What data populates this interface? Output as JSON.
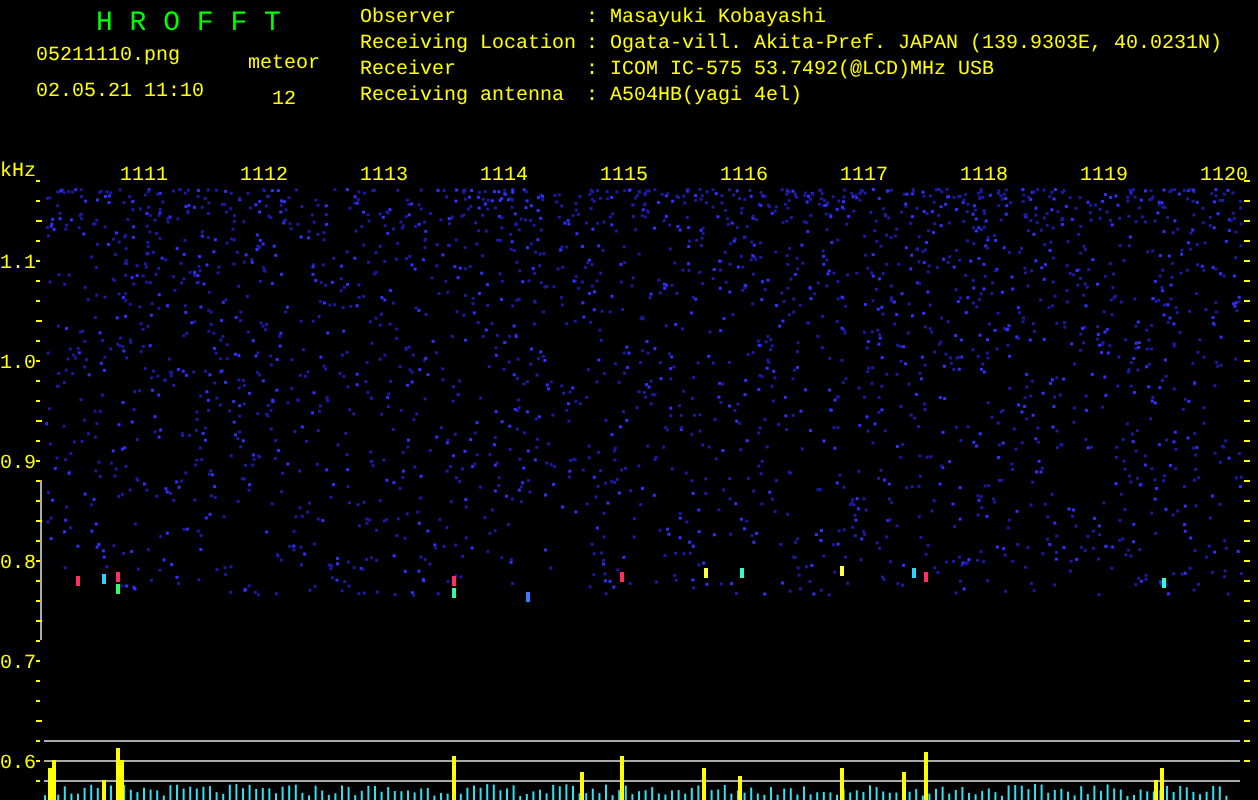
{
  "header": {
    "title": "H R O F F T",
    "file": "05211110.png",
    "timestamp": "02.05.21 11:10",
    "meteor_label": "meteor",
    "meteor_count": "12"
  },
  "info": [
    {
      "label": "Observer",
      "separator": ":",
      "value": "Masayuki Kobayashi"
    },
    {
      "label": "Receiving Location",
      "separator": ":",
      "value": "Ogata-vill. Akita-Pref. JAPAN (139.9303E, 40.0231N)"
    },
    {
      "label": "Receiver",
      "separator": ":",
      "value": "ICOM IC-575 53.7492(@LCD)MHz USB"
    },
    {
      "label": "Receiving antenna",
      "separator": ":",
      "value": "A504HB(yagi 4el)"
    }
  ],
  "plot": {
    "unit": "kHz",
    "x_labels": [
      "1111",
      "1112",
      "1113",
      "1114",
      "1115",
      "1116",
      "1117",
      "1118",
      "1119",
      "1120"
    ],
    "y_labels": [
      "1.1",
      "1.0",
      "0.9",
      "0.8",
      "0.7",
      "0.6"
    ]
  }
}
